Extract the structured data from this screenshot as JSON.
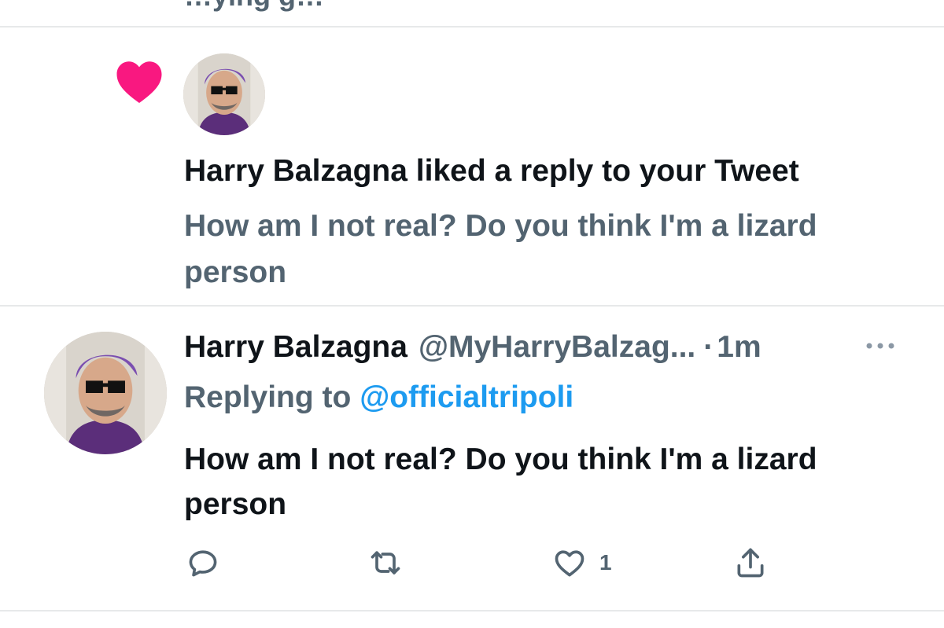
{
  "top_partial_text": "…ying g…",
  "notification": {
    "actor": "Harry Balzagna",
    "action": "liked a reply to your Tweet",
    "preview": "How am I not real? Do you think I'm a lizard person",
    "icon": "heart-icon",
    "icon_color": "#f91880"
  },
  "tweet": {
    "display_name": "Harry Balzagna",
    "handle": "@MyHarryBalzag...",
    "separator": "·",
    "time": "1m",
    "replying_label": "Replying to",
    "replying_handle": "@officialtripoli",
    "text": "How am I not real? Do you think I'm a lizard person",
    "actions": {
      "reply_icon": "reply-icon",
      "retweet_icon": "retweet-icon",
      "like_icon": "like-icon",
      "like_count": "1",
      "share_icon": "share-icon"
    }
  },
  "colors": {
    "text_primary": "#0f1419",
    "text_secondary": "#536471",
    "link": "#1d9bf0",
    "divider": "#e7e9ea"
  }
}
